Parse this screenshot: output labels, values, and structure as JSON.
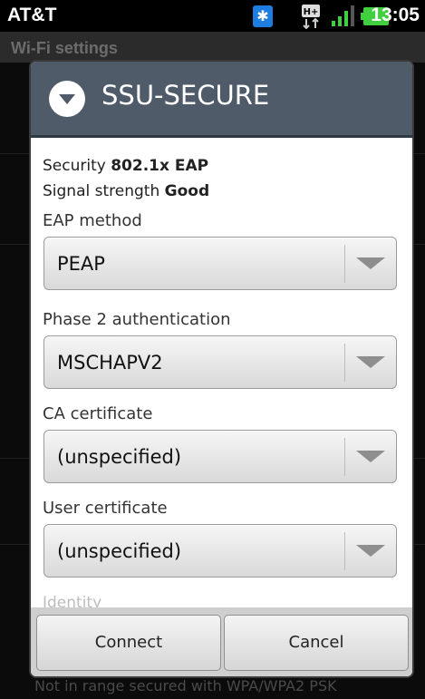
{
  "status_bar": {
    "carrier": "AT&T",
    "time": "13:05",
    "icons": [
      "bluetooth-icon",
      "data-hplus-icon",
      "signal-bars-icon",
      "battery-icon"
    ],
    "data_badge": "H+"
  },
  "background": {
    "screen_title": "Wi-Fi settings",
    "footer_text": "Not in range secured with WPA/WPA2 PSK"
  },
  "dialog": {
    "title": "SSU-SECURE",
    "security_label": "Security",
    "security_value": "802.1x EAP",
    "signal_label": "Signal strength",
    "signal_value": "Good",
    "fields": [
      {
        "label": "EAP method",
        "value": "PEAP"
      },
      {
        "label": "Phase 2 authentication",
        "value": "MSCHAPV2"
      },
      {
        "label": "CA certificate",
        "value": "(unspecified)"
      },
      {
        "label": "User certificate",
        "value": "(unspecified)"
      }
    ],
    "next_field_label": "Identity",
    "connect_label": "Connect",
    "cancel_label": "Cancel"
  },
  "colors": {
    "header_bg": "#4f5b68",
    "bluetooth": "#1e7de0",
    "battery": "#3fcf3f"
  }
}
